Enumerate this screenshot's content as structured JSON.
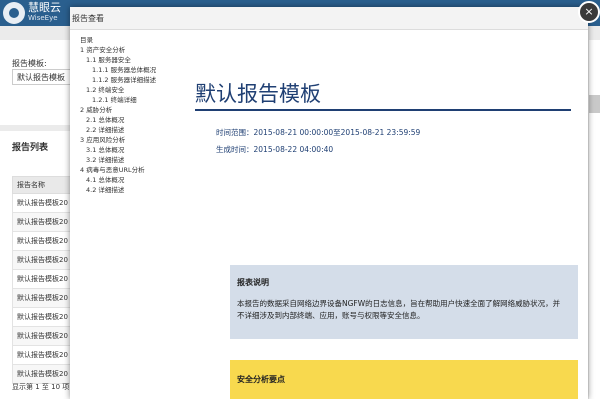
{
  "app": {
    "brand_cn": "慧眼云",
    "brand_en": "WiseEye"
  },
  "sidebar": {
    "template_label": "报告模板:",
    "template_value": "默认报告模板",
    "list_title": "报告列表",
    "table_header": "报告名称",
    "rows": [
      "默认报告模板20",
      "默认报告模板20",
      "默认报告模板20",
      "默认报告模板20",
      "默认报告模板20",
      "默认报告模板20",
      "默认报告模板20",
      "默认报告模板20",
      "默认报告模板20",
      "默认报告模板20"
    ],
    "footer": "显示第 1 至 10 项"
  },
  "dialog": {
    "title": "报告查看",
    "close": "×",
    "toc": [
      {
        "label": "目录",
        "level": 0
      },
      {
        "label": "1 资产安全分析",
        "level": 0
      },
      {
        "label": "1.1 服务器安全",
        "level": 1
      },
      {
        "label": "1.1.1 服务器总体概况",
        "level": 2
      },
      {
        "label": "1.1.2 服务器详细描述",
        "level": 2
      },
      {
        "label": "1.2 终端安全",
        "level": 1
      },
      {
        "label": "1.2.1 终端详细",
        "level": 2
      },
      {
        "label": "2 威胁分析",
        "level": 0
      },
      {
        "label": "2.1 总体概况",
        "level": 1
      },
      {
        "label": "2.2 详细描述",
        "level": 1
      },
      {
        "label": "3 应用风险分析",
        "level": 0
      },
      {
        "label": "3.1 总体概况",
        "level": 1
      },
      {
        "label": "3.2 详细描述",
        "level": 1
      },
      {
        "label": "4 病毒与恶意URL分析",
        "level": 0
      },
      {
        "label": "4.1 总体概况",
        "level": 1
      },
      {
        "label": "4.2 详细描述",
        "level": 1
      }
    ],
    "doc_title": "默认报告模板",
    "time_range": "时间范围：2015-08-21 00:00:00至2015-08-21 23:59:59",
    "gen_time": "生成时间：2015-08-22 04:00:40",
    "desc_heading": "报表说明",
    "desc_text": "本报告的数据采自网络边界设备NGFW的日志信息，旨在帮助用户快速全面了解网络威胁状况，并不详细涉及到内部终端、应用，账号与权限等安全信息。",
    "section_heading": "安全分析要点"
  },
  "colors": {
    "topbar": "#2a5f8e",
    "doc_title": "#1f3f73",
    "desc_bg": "#d4dde9",
    "section_bg": "#f8d94e"
  }
}
